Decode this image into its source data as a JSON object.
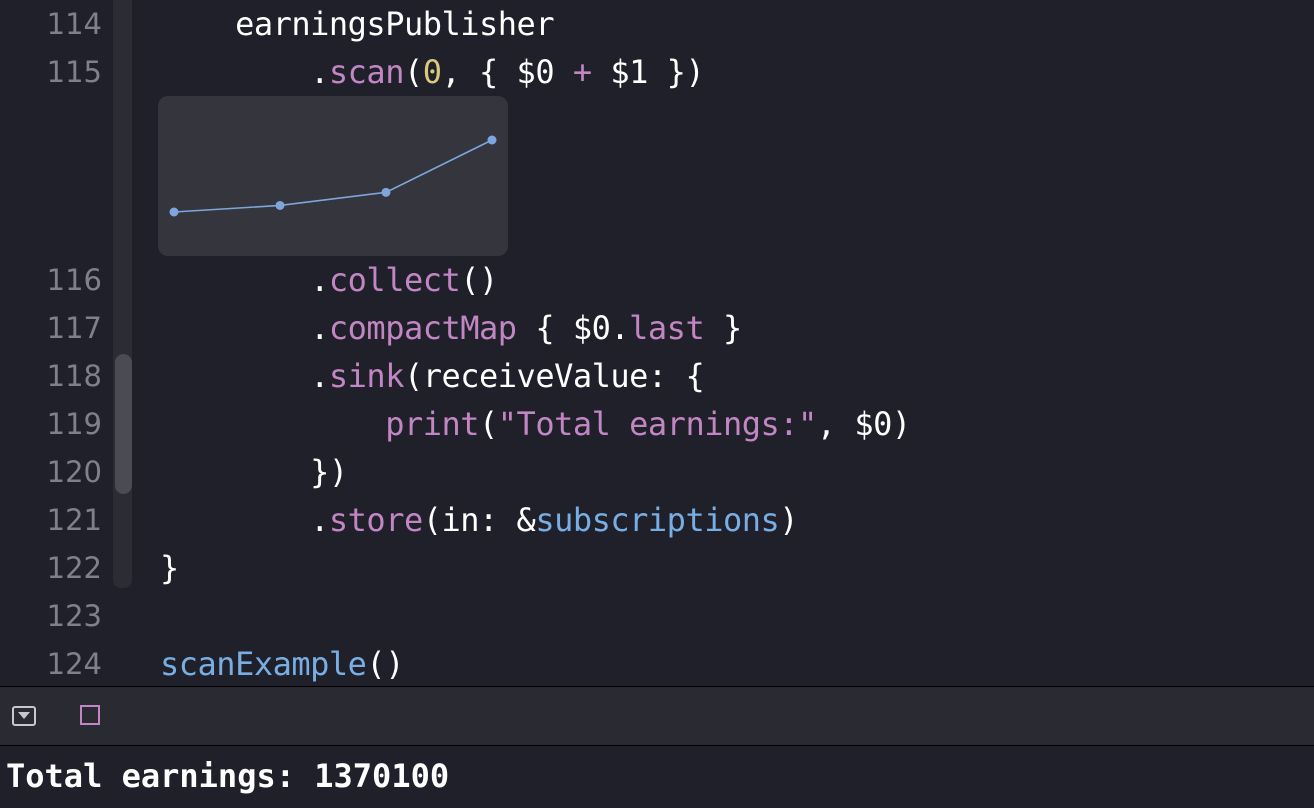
{
  "gutter": {
    "line_numbers": [
      "114",
      "115",
      "116",
      "117",
      "118",
      "119",
      "120",
      "121",
      "122",
      "123",
      "124"
    ]
  },
  "code": {
    "l114": {
      "t0": "    earningsPublisher"
    },
    "l115": {
      "t0": "        .",
      "t1": "scan",
      "t2": "(",
      "t3": "0",
      "t4": ", { $0 ",
      "t5": "+",
      "t6": " $1 })"
    },
    "l116": {
      "t0": "        .",
      "t1": "collect",
      "t2": "()"
    },
    "l117": {
      "t0": "        .",
      "t1": "compactMap",
      "t2": " { $0.",
      "t3": "last",
      "t4": " }"
    },
    "l118": {
      "t0": "        .",
      "t1": "sink",
      "t2": "(receiveValue: {"
    },
    "l119": {
      "t0": "            ",
      "t1": "print",
      "t2": "(",
      "t3": "\"Total earnings:\"",
      "t4": ", $0)"
    },
    "l120": {
      "t0": "        })"
    },
    "l121": {
      "t0": "        .",
      "t1": "store",
      "t2": "(in: &",
      "t3": "subscriptions",
      "t4": ")"
    },
    "l122": {
      "t0": "}"
    },
    "l123": {
      "t0": ""
    },
    "l124": {
      "t0": "scanExample",
      "t1": "()"
    }
  },
  "quick_look": {
    "series_values": [
      1,
      2,
      4,
      12
    ],
    "line_color": "#7ea6dc"
  },
  "debug_bar": {
    "hide_icon": "triangle-down-icon",
    "console_icon": "square-icon"
  },
  "console": {
    "output": "Total earnings: 1370100"
  },
  "colors": {
    "background": "#1f2029",
    "keyword": "#c186c3",
    "number": "#d9c97c",
    "project": "#78aee3",
    "gutter_text": "#7f8089"
  }
}
